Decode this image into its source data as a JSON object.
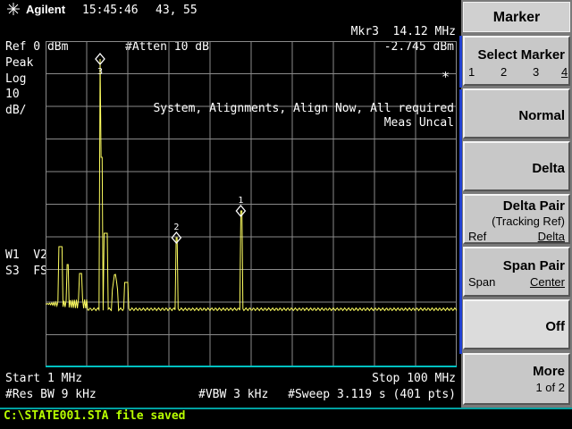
{
  "header": {
    "brand": "Agilent",
    "time": "15:45:46",
    "date_parts": [
      "43,",
      "55"
    ],
    "marker_readout_freq": "Mkr3  14.12 MHz",
    "marker_readout_amp": "-2.745 dBm",
    "ref": "Ref 0 dBm",
    "atten": "#Atten 10 dB"
  },
  "left_labels": {
    "detector": "Peak",
    "scale": "Log",
    "scale_value": "10",
    "scale_unit": "dB/",
    "trace_line1": "W1  V2",
    "trace_line2": "S3  FS"
  },
  "messages": {
    "alignment": "System, Alignments, Align Now, All required",
    "meas_uncal": "Meas Uncal",
    "star": "*"
  },
  "footer": {
    "start": "Start 1 MHz",
    "stop": "Stop 100 MHz",
    "res_bw": "#Res BW 9 kHz",
    "vbw": "#VBW 3 kHz",
    "sweep": "#Sweep 3.119 s (401 pts)"
  },
  "status_bar": {
    "message": "C:\\STATE001.STA file saved"
  },
  "softkeys": {
    "title": "Marker",
    "select_marker": {
      "label": "Select Marker",
      "options": [
        "1",
        "2",
        "3",
        "4"
      ],
      "selected": "4"
    },
    "normal": "Normal",
    "delta": "Delta",
    "delta_pair": {
      "label": "Delta Pair",
      "sub": "(Tracking Ref)",
      "left": "Ref",
      "right": "Delta"
    },
    "span_pair": {
      "label": "Span Pair",
      "left": "Span",
      "right": "Center"
    },
    "off": "Off",
    "more": {
      "label": "More",
      "sub": "1 of 2"
    }
  },
  "markers": [
    {
      "label": "3",
      "freq_mhz": 14.12
    },
    {
      "label": "2",
      "freq_mhz": 32.5
    },
    {
      "label": "1",
      "freq_mhz": 48.0
    }
  ],
  "colors": {
    "trace": "#ffff60",
    "grid": "#8a8a8a",
    "status_text": "#b8ff00",
    "cyan_line": "#00c0c0"
  }
}
